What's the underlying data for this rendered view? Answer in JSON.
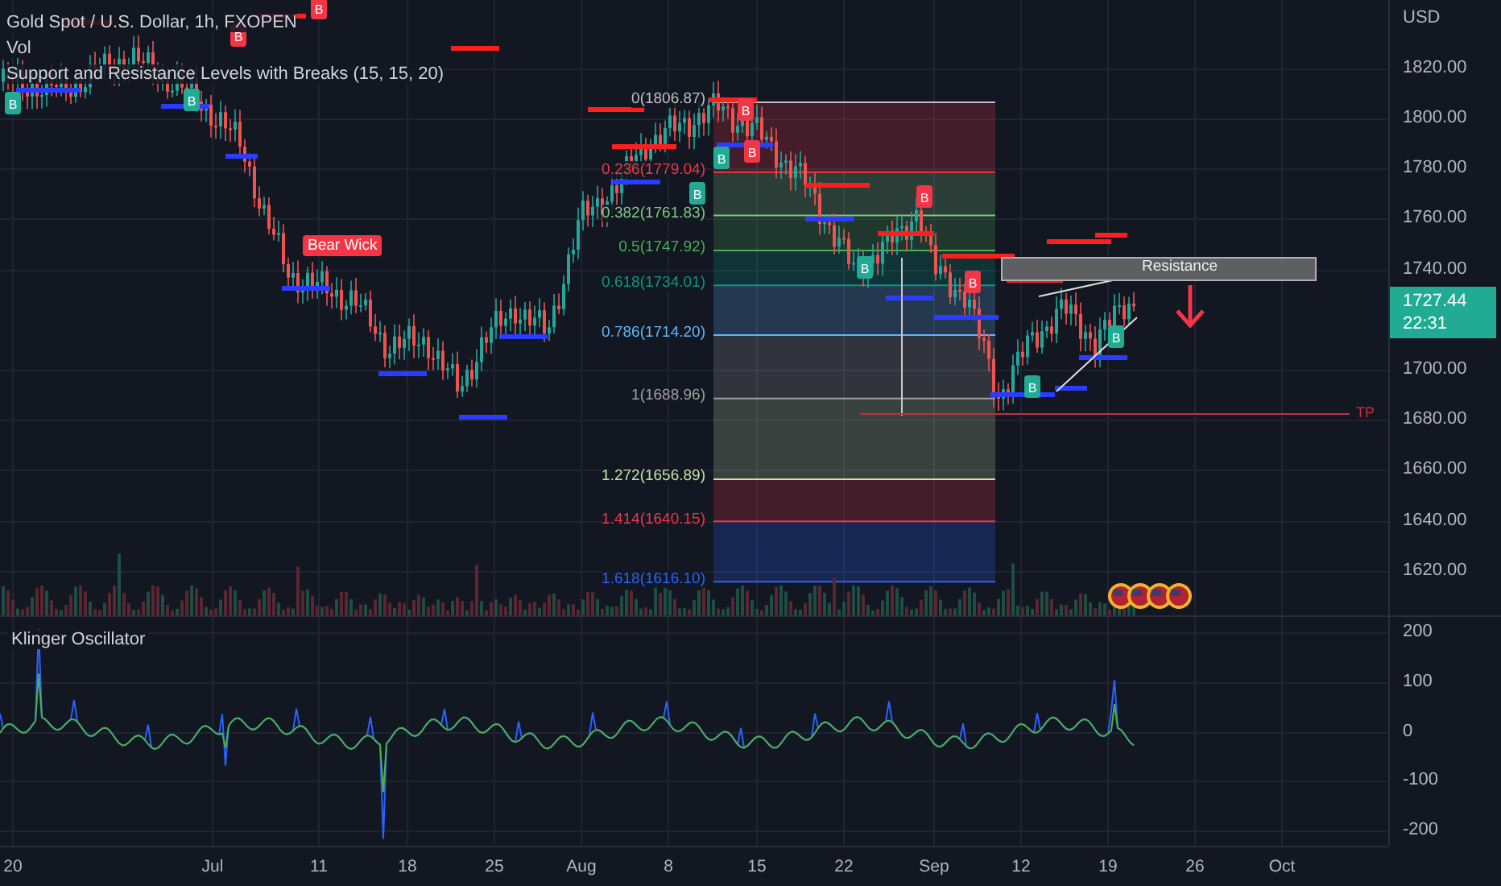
{
  "legend": {
    "symbol": "Gold Spot / U.S. Dollar, 1h, FXOPEN",
    "volume": "Vol",
    "indicator": "Support and Resistance Levels with Breaks (15, 15, 20)"
  },
  "fib_levels": [
    {
      "label": "0(1806.87)",
      "color": "#c0c0c0"
    },
    {
      "label": "0.236(1779.04)",
      "color": "#f23645"
    },
    {
      "label": "0.382(1761.83)",
      "color": "#81c784"
    },
    {
      "label": "0.5(1747.92)",
      "color": "#4caf50"
    },
    {
      "label": "0.618(1734.01)",
      "color": "#089981"
    },
    {
      "label": "0.786(1714.20)",
      "color": "#64b5f6"
    },
    {
      "label": "1(1688.96)",
      "color": "#a0a0a0"
    },
    {
      "label": "1.272(1656.89)",
      "color": "#c5e1a5"
    },
    {
      "label": "1.414(1640.15)",
      "color": "#f23645"
    },
    {
      "label": "1.618(1616.10)",
      "color": "#2962ff"
    }
  ],
  "signals": [
    {
      "label": "B",
      "color": "#f23645"
    },
    {
      "label": "B",
      "color": "#f23645"
    },
    {
      "label": "B",
      "color": "#f23645"
    },
    {
      "label": "B",
      "color": "#f23645"
    },
    {
      "label": "B",
      "color": "#f23645"
    },
    {
      "label": "B",
      "color": "#f23645"
    },
    {
      "label": "B",
      "color": "#22ab94"
    },
    {
      "label": "B",
      "color": "#22ab94"
    },
    {
      "label": "B",
      "color": "#22ab94"
    },
    {
      "label": "B",
      "color": "#22ab94"
    },
    {
      "label": "B",
      "color": "#22ab94"
    },
    {
      "label": "B",
      "color": "#22ab94"
    },
    {
      "label": "B",
      "color": "#22ab94"
    }
  ],
  "annotations": {
    "bear_wick": "Bear Wick",
    "resistance": "Resistance",
    "target": "TP"
  },
  "price_axis": {
    "currency": "USD",
    "ticks": [
      "1820.00",
      "1800.00",
      "1780.00",
      "1760.00",
      "1740.00",
      "1700.00",
      "1680.00",
      "1660.00",
      "1640.00",
      "1620.00"
    ],
    "last_price": "1727.44",
    "countdown": "22:31"
  },
  "oscillator": {
    "title": "Klinger Oscillator",
    "ticks": [
      "200",
      "100",
      "0",
      "-100",
      "-200"
    ]
  },
  "time_axis": [
    "20",
    "Jul",
    "11",
    "18",
    "25",
    "Aug",
    "8",
    "15",
    "22",
    "Sep",
    "12",
    "19",
    "26",
    "Oct"
  ]
}
